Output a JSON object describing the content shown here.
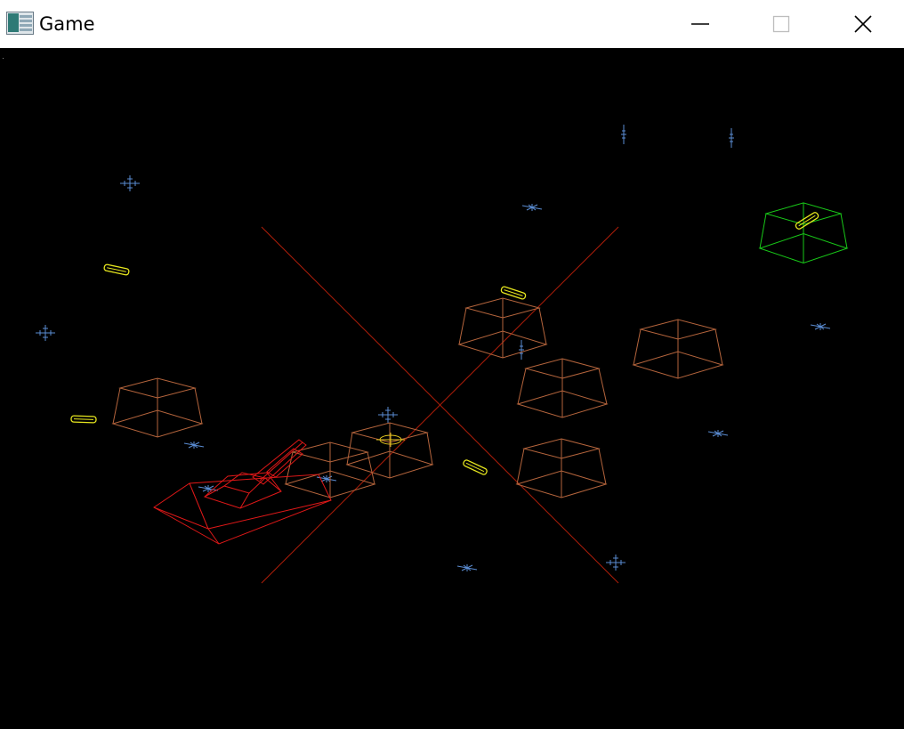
{
  "window": {
    "title": "Game",
    "icon": "app-window-icon",
    "controls": {
      "minimize": "minimize-icon",
      "maximize": "maximize-icon",
      "close": "close-icon"
    }
  },
  "scene": {
    "background": "#000000",
    "colors": {
      "crosshair_lines": "#b01e0a",
      "obstacle_boxes": "#b4643c",
      "player_tank": "#e01818",
      "target_box": "#18c818",
      "pickups": "#e6e61e",
      "reticle": "#e6c81e",
      "stars": "#5a8cd2"
    },
    "player_tank_count": 1,
    "obstacle_box_count": 8,
    "target_box_count": 1,
    "pickup_count": 5,
    "star_marker_count": 18
  }
}
